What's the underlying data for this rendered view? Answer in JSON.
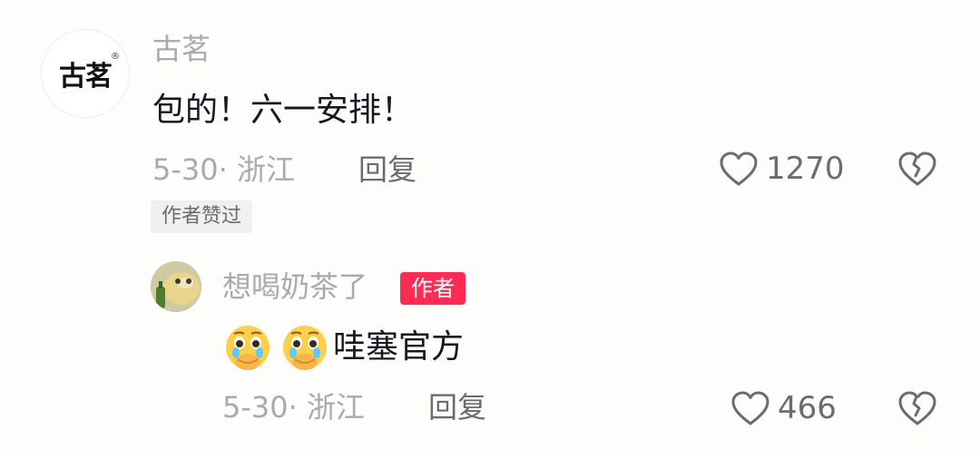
{
  "comment": {
    "avatar_text": "古茗",
    "avatar_reg": "®",
    "username": "古茗",
    "text": "包的！六一安排！",
    "date_location": "5-30· 浙江",
    "reply_label": "回复",
    "like_count": "1270",
    "author_liked_label": "作者赞过"
  },
  "reply": {
    "username": "想喝奶茶了",
    "author_tag": "作者",
    "emojis": [
      "pleading-face-emoji",
      "pleading-face-emoji"
    ],
    "text": "哇塞官方",
    "date_location": "5-30· 浙江",
    "reply_label": "回复",
    "like_count": "466"
  },
  "icons": {
    "like": "heart-outline-icon",
    "dislike": "broken-heart-icon"
  },
  "colors": {
    "accent": "#fe2c55",
    "secondary_text": "#a9aaae",
    "action_text": "#6b6c70"
  }
}
